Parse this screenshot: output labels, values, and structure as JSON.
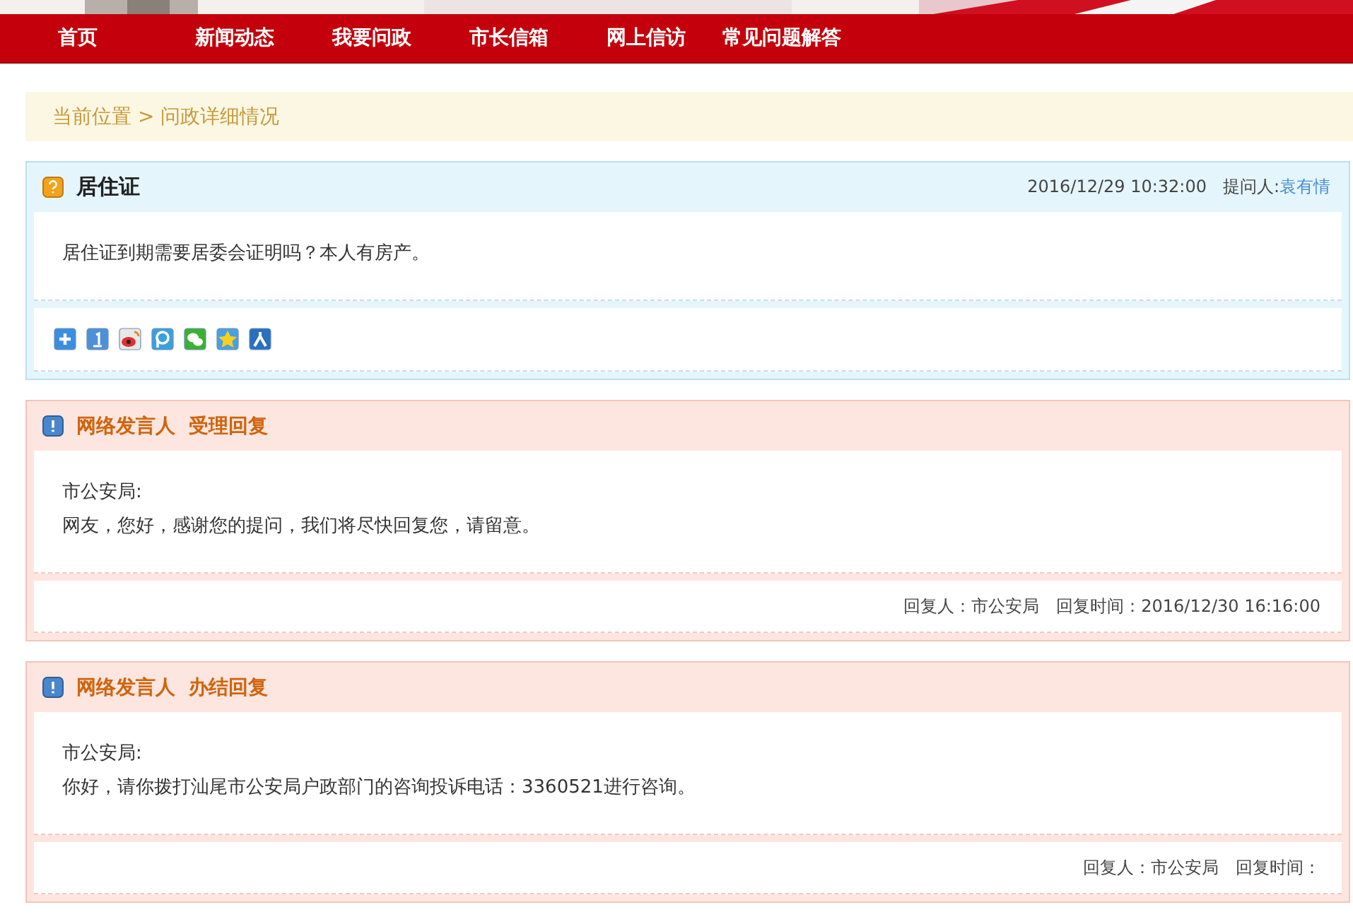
{
  "nav": [
    {
      "label": "首页"
    },
    {
      "label": "新闻动态"
    },
    {
      "label": "我要问政"
    },
    {
      "label": "市长信箱"
    },
    {
      "label": "网上信访"
    },
    {
      "label": "常见问题解答"
    }
  ],
  "breadcrumb": "当前位置 > 问政详细情况",
  "question": {
    "title": "居住证",
    "time": "2016/12/29 10:32:00",
    "asker_label": "提问人:",
    "asker": "袁有情",
    "body": "居住证到期需要居委会证明吗？本人有房产。",
    "share_icons": [
      {
        "kind": "plus"
      },
      {
        "kind": "one"
      },
      {
        "kind": "weibo"
      },
      {
        "kind": "p"
      },
      {
        "kind": "wechat"
      },
      {
        "kind": "qzone"
      },
      {
        "kind": "renren"
      }
    ]
  },
  "replies": [
    {
      "title": "网络发言人  受理回复",
      "dept": "市公安局:",
      "body": "网友，您好，感谢您的提问，我们将尽快回复您，请留意。",
      "replier": "回复人：市公安局",
      "time": "回复时间：2016/12/30 16:16:00"
    },
    {
      "title": "网络发言人  办结回复",
      "dept": "市公安局:",
      "body": "你好，请你拨打汕尾市公安局户政部门的咨询投诉电话：3360521进行咨询。",
      "replier": "回复人：市公安局",
      "time": "回复时间："
    }
  ]
}
